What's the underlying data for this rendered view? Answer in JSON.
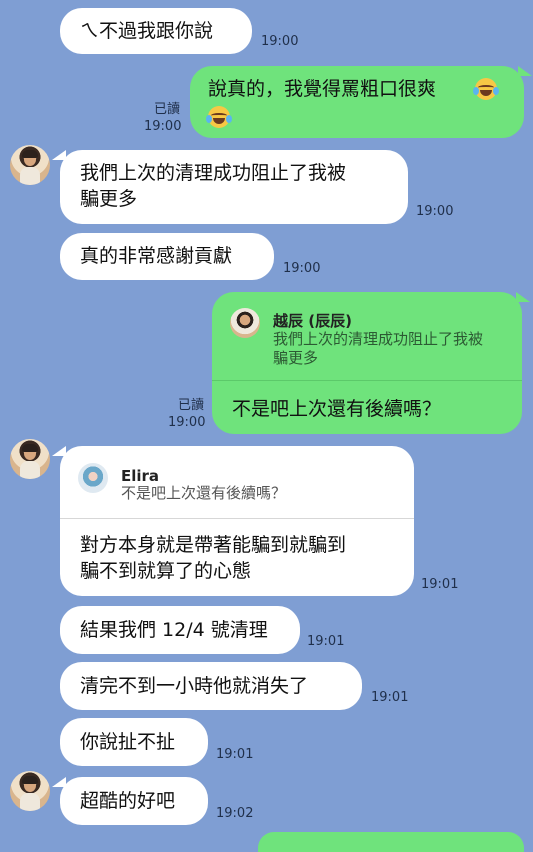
{
  "messages": {
    "m1": {
      "text": "ㄟ不過我跟你說",
      "time": "19:00"
    },
    "m2": {
      "line1": "說真的，我覺得罵粗口很爽",
      "emoji": "face-with-tears-of-joy",
      "read": "已讀",
      "time": "19:00"
    },
    "m3": {
      "line1": "我們上次的清理成功阻止了我被",
      "line2": "騙更多",
      "time": "19:00"
    },
    "m4": {
      "text": "真的非常感謝貢獻",
      "time": "19:00"
    },
    "m5": {
      "reply_name": "越辰 (辰辰)",
      "reply_line1": "我們上次的清理成功阻止了我被",
      "reply_line2": "騙更多",
      "text": "不是吧上次還有後續嗎？",
      "read": "已讀",
      "time": "19:00"
    },
    "m6": {
      "reply_name": "Elira",
      "reply_text": "不是吧上次還有後續嗎？",
      "line1": "對方本身就是帶著能騙到就騙到",
      "line2": "騙不到就算了的心態",
      "time": "19:01"
    },
    "m7": {
      "text": "結果我們 12/4 號清理",
      "time": "19:01"
    },
    "m8": {
      "text": "清完不到一小時他就消失了",
      "time": "19:01"
    },
    "m9": {
      "text": "你說扯不扯",
      "time": "19:01"
    },
    "m10": {
      "text": "超酷的好吧",
      "time": "19:02"
    }
  },
  "colors": {
    "background": "#7f9ed3",
    "incoming_bubble": "#ffffff",
    "outgoing_bubble": "#6fe37c"
  }
}
